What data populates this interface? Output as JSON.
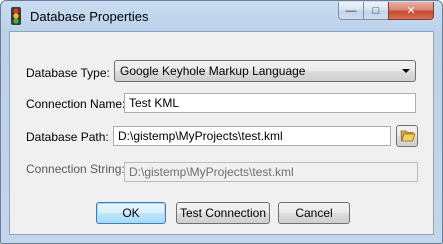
{
  "window": {
    "title": "Database Properties",
    "minimize_symbol": "—",
    "maximize_symbol": "□",
    "close_symbol": "✕"
  },
  "form": {
    "database_type": {
      "label": "Database Type:",
      "selected": "Google Keyhole Markup Language"
    },
    "connection_name": {
      "label": "Connection Name:",
      "value": "Test KML"
    },
    "database_path": {
      "label": "Database Path:",
      "value": "D:\\gistemp\\MyProjects\\test.kml"
    },
    "connection_string": {
      "label": "Connection String:",
      "value": "D:\\gistemp\\MyProjects\\test.kml"
    }
  },
  "buttons": {
    "ok": "OK",
    "test_connection": "Test Connection",
    "cancel": "Cancel"
  },
  "icons": {
    "app": "traffic-light-icon",
    "browse": "folder-open-icon"
  },
  "colors": {
    "folder": "#e8c252",
    "default_button_border": "#3c7fb1"
  }
}
